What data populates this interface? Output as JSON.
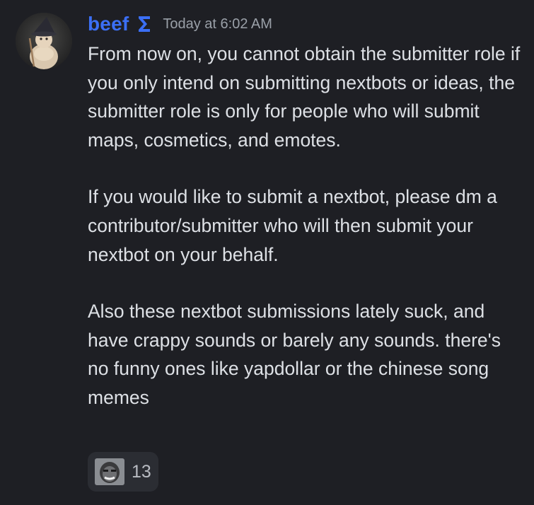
{
  "message": {
    "author": {
      "username": "beef",
      "username_color": "#3b6ff5",
      "avatar_icon": "wizard-avatar-icon",
      "role_icon": "sigma-role-icon"
    },
    "timestamp": "Today at 6:02 AM",
    "paragraphs": [
      "From now on, you cannot obtain the submitter role if you only intend on submitting nextbots or ideas, the submitter role is only for people who will submit maps, cosmetics, and emotes.",
      "If you would like to submit a nextbot, please dm a contributor/submitter who will then submit your nextbot on your behalf.",
      "Also these nextbot submissions lately suck, and have crappy sounds or barely any sounds. there's no funny ones like yapdollar or the chinese song memes"
    ],
    "reactions": [
      {
        "emoji_icon": "custom-face-emoji-icon",
        "count": "13"
      }
    ]
  },
  "colors": {
    "background": "#1e1f24",
    "text": "#dde0e5",
    "timestamp": "#9aa0a8",
    "reaction_bg": "#2b2d33"
  }
}
